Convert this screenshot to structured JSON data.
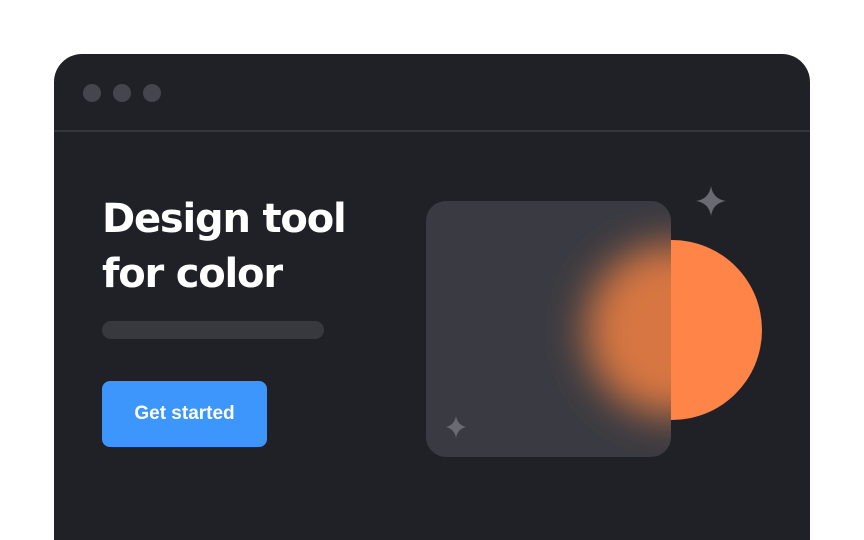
{
  "window": {
    "controls": [
      "window-dot",
      "window-dot",
      "window-dot"
    ]
  },
  "hero": {
    "headline_line1": "Design tool",
    "headline_line2": "for color",
    "cta_label": "Get started"
  },
  "colors": {
    "window_bg": "#202126",
    "accent_blue": "#3d96fb",
    "accent_orange": "#ff8447",
    "card": "#3a3b42",
    "sparkle": "#6a6b72"
  },
  "icons": [
    "sparkle-icon",
    "sparkle-icon"
  ]
}
